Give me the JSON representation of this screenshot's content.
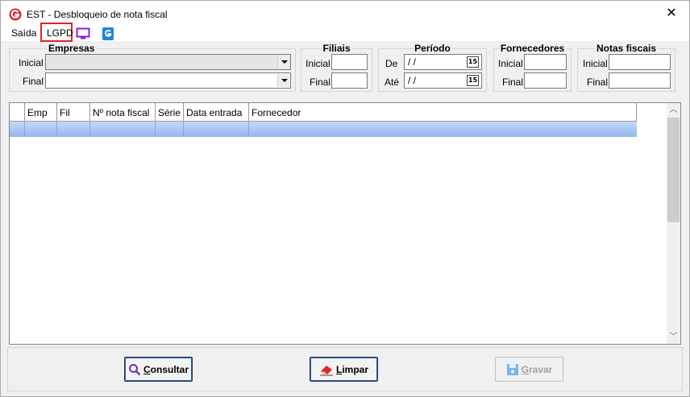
{
  "window": {
    "title": "EST - Desbloqueio de nota fiscal",
    "close": "✕"
  },
  "menu": {
    "saida": "Saída",
    "lgpd": "LGPD",
    "icons": [
      "monitor-icon",
      "g-app-icon"
    ]
  },
  "filters": {
    "empresas": {
      "title": "Empresas",
      "inicial_label": "Inicial",
      "final_label": "Final",
      "inicial_value": "",
      "final_value": ""
    },
    "filiais": {
      "title": "Filiais",
      "inicial_label": "Inicial",
      "final_label": "Final",
      "inicial_value": "",
      "final_value": ""
    },
    "periodo": {
      "title": "Período",
      "de_label": "De",
      "ate_label": "Até",
      "de_value": " / /",
      "ate_value": " / /",
      "calendar_glyph": "15"
    },
    "fornecedores": {
      "title": "Fornecedores",
      "inicial_label": "Inicial",
      "final_label": "Final",
      "inicial_value": "",
      "final_value": ""
    },
    "notas": {
      "title": "Notas fiscais",
      "inicial_label": "Inicial",
      "final_label": "Final",
      "inicial_value": "",
      "final_value": ""
    }
  },
  "grid": {
    "columns": [
      "Emp",
      "Fil",
      "Nº nota fiscal",
      "Série",
      "Data entrada",
      "Fornecedor"
    ],
    "rows": [
      [
        "",
        "",
        "",
        "",
        "",
        ""
      ]
    ],
    "scroll_up": "︿",
    "scroll_down": "﹀"
  },
  "buttons": {
    "consultar": {
      "first": "C",
      "rest": "onsultar"
    },
    "limpar": {
      "first": "L",
      "rest": "impar"
    },
    "gravar": {
      "first": "G",
      "rest": "ravar"
    }
  },
  "colors": {
    "selection": "#94b6ec",
    "lgpd_highlight": "#e32222",
    "brand_red": "#d7262e",
    "accent_blue": "#1a66d1"
  }
}
